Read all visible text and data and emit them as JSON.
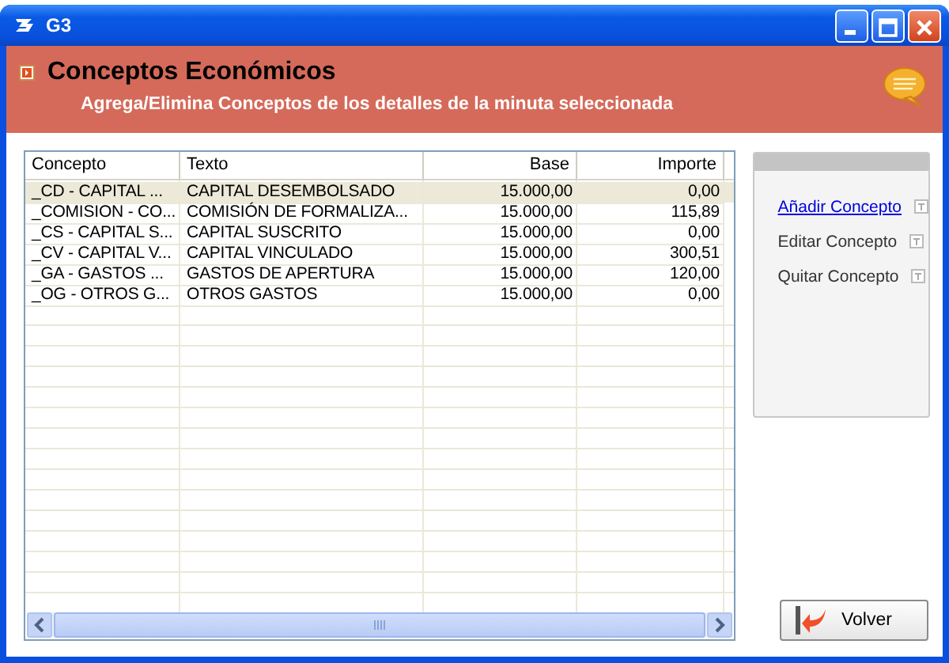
{
  "window": {
    "title": "G3"
  },
  "header": {
    "title": "Conceptos Económicos",
    "subtitle": "Agrega/Elimina Conceptos de los detalles de la minuta seleccionada"
  },
  "table": {
    "columns": [
      {
        "label": "Concepto"
      },
      {
        "label": "Texto"
      },
      {
        "label": "Base"
      },
      {
        "label": "Importe"
      }
    ],
    "rows": [
      {
        "selected": true,
        "cells": [
          "_CD - CAPITAL ...",
          "CAPITAL DESEMBOLSADO",
          "15.000,00",
          "0,00"
        ]
      },
      {
        "selected": false,
        "cells": [
          "_COMISION - CO...",
          "COMISIÓN DE FORMALIZA...",
          "15.000,00",
          "115,89"
        ]
      },
      {
        "selected": false,
        "cells": [
          "_CS - CAPITAL S...",
          "CAPITAL SUSCRITO",
          "15.000,00",
          "0,00"
        ]
      },
      {
        "selected": false,
        "cells": [
          "_CV - CAPITAL V...",
          "CAPITAL VINCULADO",
          "15.000,00",
          "300,51"
        ]
      },
      {
        "selected": false,
        "cells": [
          "_GA - GASTOS ...",
          "GASTOS DE APERTURA",
          "15.000,00",
          "120,00"
        ]
      },
      {
        "selected": false,
        "cells": [
          "_OG - OTROS G...",
          "OTROS GASTOS",
          "15.000,00",
          "0,00"
        ]
      }
    ]
  },
  "actions": [
    {
      "label": "Añadir Concepto",
      "kind": "link"
    },
    {
      "label": "Editar Concepto",
      "kind": "plain"
    },
    {
      "label": "Quitar Concepto",
      "kind": "plain"
    }
  ],
  "buttons": [
    {
      "label": "Volver"
    }
  ]
}
